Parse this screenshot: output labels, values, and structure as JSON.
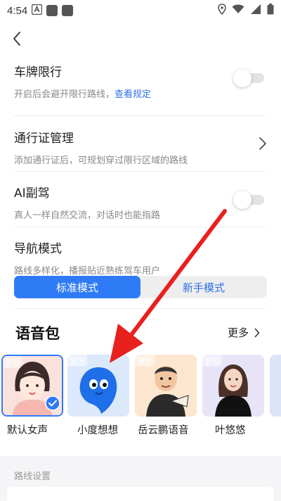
{
  "status_bar": {
    "time": "4:54",
    "icons": [
      "notification-a-icon",
      "app-icon",
      "app-icon",
      "location-icon",
      "wifi-icon",
      "signal-icon",
      "battery-icon"
    ]
  },
  "nav": {
    "back_icon": "chevron-left-icon"
  },
  "settings": {
    "plate_restriction": {
      "title": "车牌限行",
      "desc": "开启后会避开限行路线，",
      "link": "查看规定",
      "toggle_on": false
    },
    "pass_management": {
      "title": "通行证管理",
      "desc": "添加通行证后，可规划穿过限行区域的路线"
    },
    "ai_copilot": {
      "title": "AI副驾",
      "desc": "真人一样自然交流，对话时也能指路",
      "toggle_on": false
    },
    "nav_mode": {
      "title": "导航模式",
      "desc": "路线多样化，播报贴近熟练驾车用户",
      "options": [
        "标准模式",
        "新手模式"
      ],
      "selected": "标准模式"
    }
  },
  "voice_pack": {
    "title": "语音包",
    "more": "更多",
    "items": [
      {
        "name": "默认女声",
        "tag": "官方",
        "selected": true
      },
      {
        "name": "小度想想",
        "tag": "官方",
        "selected": false
      },
      {
        "name": "岳云鹏语音",
        "tag": "官方",
        "selected": false
      },
      {
        "name": "叶悠悠",
        "tag": "官方",
        "selected": false
      }
    ]
  },
  "route_settings": {
    "title": "路线设置"
  },
  "colors": {
    "accent": "#2f7bf5",
    "link": "#2f6fe6",
    "annotation_arrow": "#e8201e"
  }
}
